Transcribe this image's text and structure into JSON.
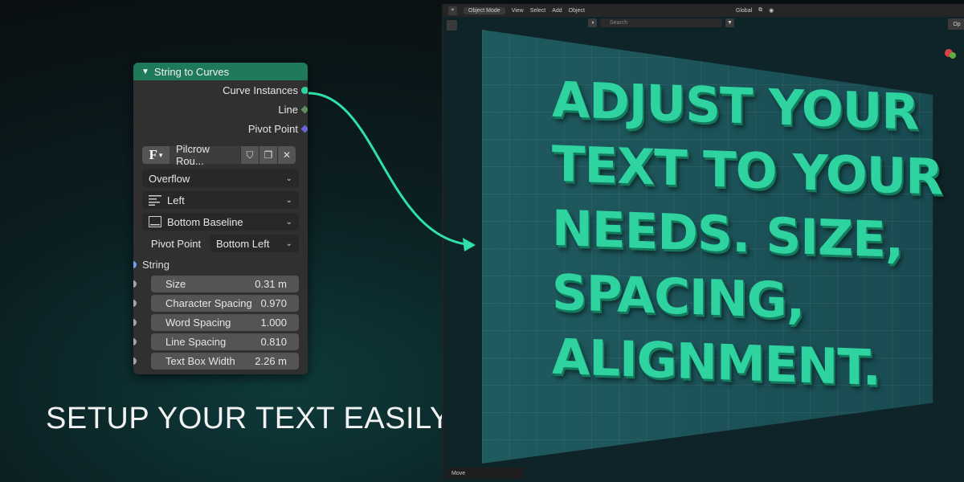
{
  "node": {
    "title": "String to Curves",
    "outputs": [
      "Curve Instances",
      "Line",
      "Pivot Point"
    ],
    "font_name": "Pilcrow Rou...",
    "overflow": "Overflow",
    "align_x": "Left",
    "align_y": "Bottom Baseline",
    "pivot_label": "Pivot Point",
    "pivot_value": "Bottom Left",
    "string_label": "String",
    "fields": [
      {
        "label": "Size",
        "value": "0.31 m"
      },
      {
        "label": "Character Spacing",
        "value": "0.970"
      },
      {
        "label": "Word Spacing",
        "value": "1.000"
      },
      {
        "label": "Line Spacing",
        "value": "0.810"
      },
      {
        "label": "Text Box Width",
        "value": "2.26 m"
      }
    ]
  },
  "caption": "SETUP YOUR TEXT EASILY",
  "viewport": {
    "mode": "Object Mode",
    "menus": [
      "View",
      "Select",
      "Add",
      "Object"
    ],
    "orientation": "Global",
    "search_placeholder": "Search",
    "options_label": "Op",
    "status": "Move",
    "text_lines": [
      "ADJUST YOUR",
      "TEXT TO YOUR",
      "NEEDS. SIZE,",
      "SPACING,",
      "ALIGNMENT."
    ]
  },
  "colors": {
    "header": "#1f7a5c",
    "text_green": "#2ed3a0",
    "socket_teal": "#2fd1a3"
  }
}
